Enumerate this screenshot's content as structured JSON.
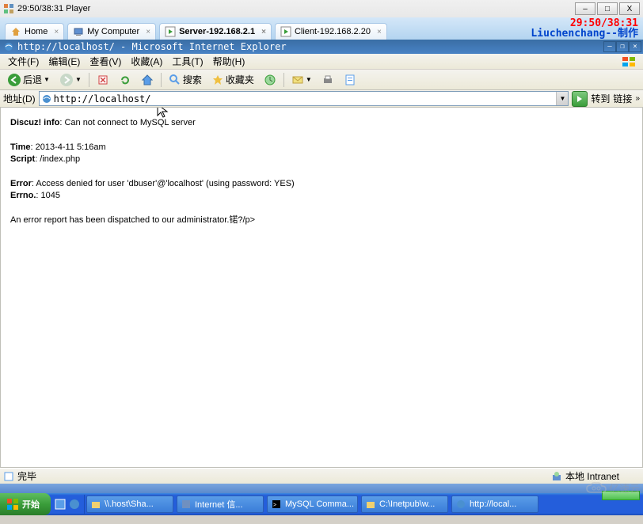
{
  "player": {
    "title": "29:50/38:31 Player",
    "controls": {
      "min": "–",
      "max": "□",
      "close": "X"
    }
  },
  "overlays": {
    "timer": "29:50/38:31",
    "watermark": "Liuchenchang--制作",
    "cloud_text": "亿速云"
  },
  "vm_tabs": [
    {
      "label": "Home",
      "icon": "home-icon"
    },
    {
      "label": "My Computer",
      "icon": "computer-icon"
    },
    {
      "label": "Server-192.168.2.1",
      "icon": "play-icon",
      "active": true
    },
    {
      "label": "Client-192.168.2.20",
      "icon": "play-icon"
    }
  ],
  "ie": {
    "title": "http://localhost/ - Microsoft Internet Explorer",
    "menu": [
      {
        "label": "文件(F)"
      },
      {
        "label": "编辑(E)"
      },
      {
        "label": "查看(V)"
      },
      {
        "label": "收藏(A)"
      },
      {
        "label": "工具(T)"
      },
      {
        "label": "帮助(H)"
      }
    ],
    "toolbar": {
      "back": "后退",
      "search": "搜索",
      "favorites": "收藏夹"
    },
    "address": {
      "label": "地址(D)",
      "url": "http://localhost/",
      "go": "转到",
      "links": "链接"
    },
    "status": {
      "done": "完毕",
      "zone": "本地 Intranet"
    }
  },
  "page": {
    "info_label": "Discuz! info",
    "info_text": ": Can not connect to MySQL server",
    "time_label": "Time",
    "time_text": ": 2013-4-11 5:16am",
    "script_label": "Script",
    "script_text": ": /index.php",
    "error_label": "Error",
    "error_text": ": Access denied for user 'dbuser'@'localhost' (using password: YES)",
    "errno_label": "Errno.",
    "errno_text": ": 1045",
    "dispatch_text": "An error report has been dispatched to our administrator.锘?/p>"
  },
  "taskbar": {
    "start": "开始",
    "tasks": [
      {
        "label": "\\\\.host\\Sha..."
      },
      {
        "label": "Internet 信..."
      },
      {
        "label": "MySQL Comma..."
      },
      {
        "label": "C:\\Inetpub\\w..."
      },
      {
        "label": "http://local..."
      }
    ]
  }
}
